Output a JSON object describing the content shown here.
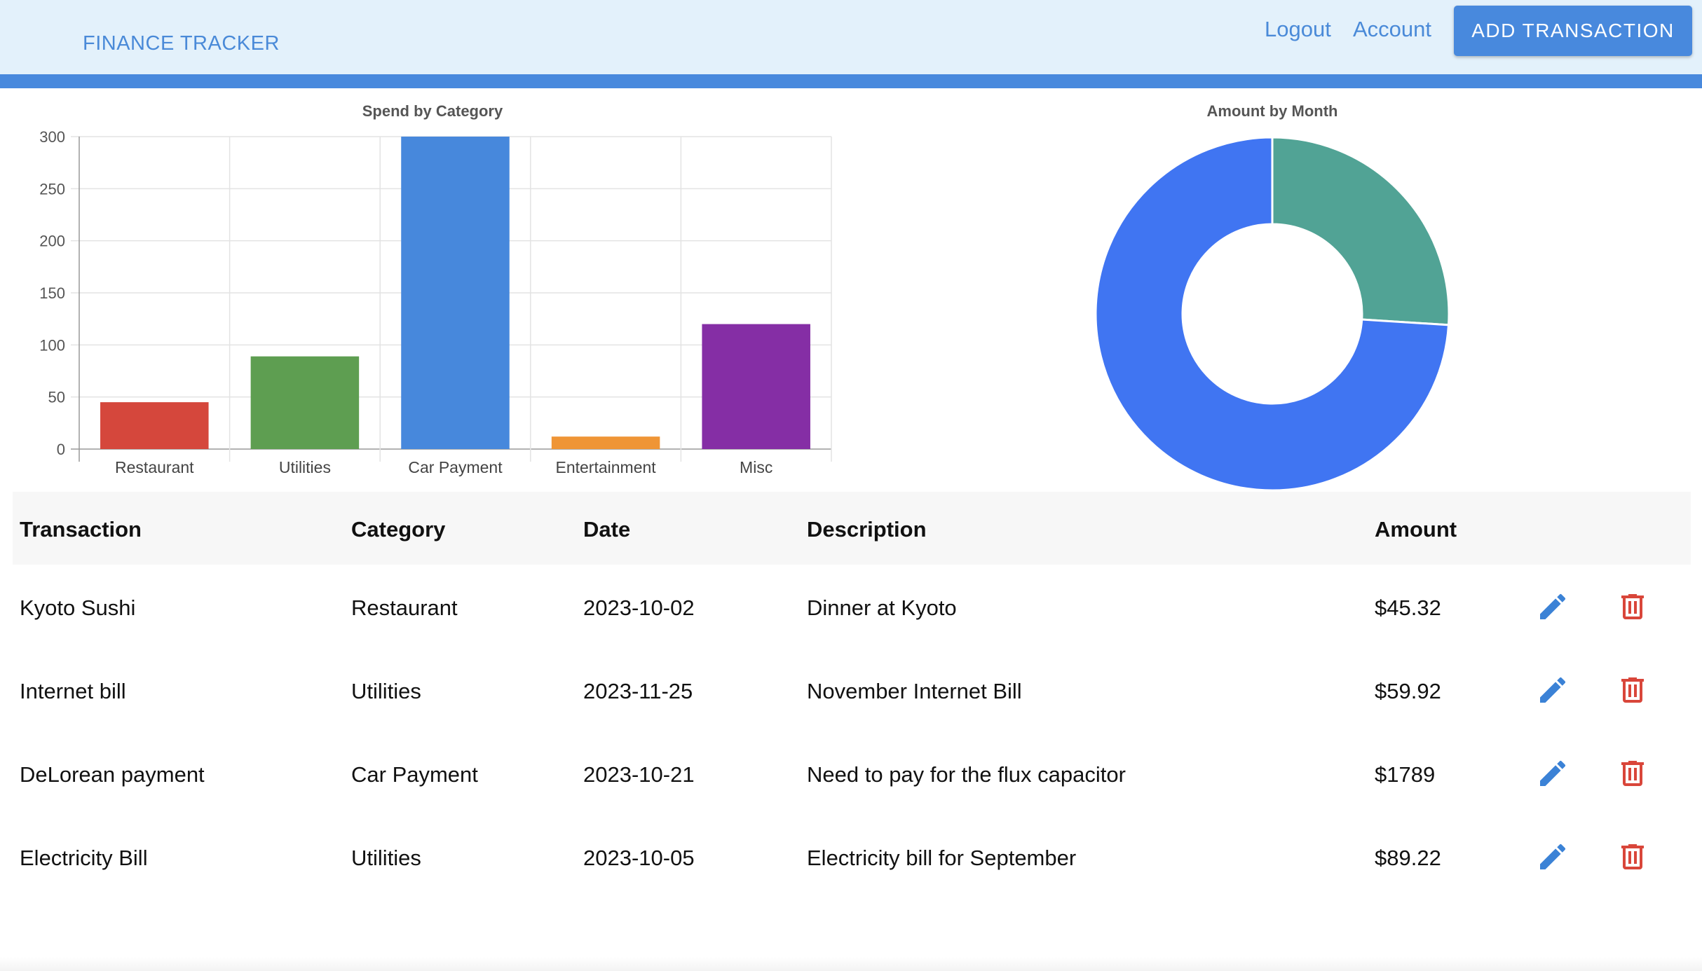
{
  "header": {
    "brand": "FINANCE TRACKER",
    "logout_label": "Logout",
    "account_label": "Account",
    "add_transaction_label": "ADD TRANSACTION"
  },
  "colors": {
    "accent": "#4889dd",
    "header_bg": "#e3f1fb",
    "edit_icon": "#3b82d6",
    "delete_icon": "#d9463a"
  },
  "chart_data": [
    {
      "type": "bar",
      "title": "Spend by Category",
      "categories": [
        "Restaurant",
        "Utilities",
        "Car Payment",
        "Entertainment",
        "Misc"
      ],
      "values": [
        45,
        89,
        300,
        12,
        120
      ],
      "colors": [
        "#d5473c",
        "#5e9e51",
        "#4788dc",
        "#ef9536",
        "#852ea5"
      ],
      "yticks": [
        0,
        50,
        100,
        150,
        200,
        250,
        300
      ],
      "ylim": [
        0,
        300
      ],
      "grid": true,
      "legend": "none"
    },
    {
      "type": "pie",
      "subtype": "donut",
      "title": "Amount by Month",
      "values": [
        1789,
        45
      ],
      "display_fractions": [
        0.74,
        0.26
      ],
      "colors": [
        "#4075f2",
        "#51a395"
      ],
      "legend": "none"
    }
  ],
  "table": {
    "headers": [
      "Transaction",
      "Category",
      "Date",
      "Description",
      "Amount"
    ],
    "rows": [
      [
        "Kyoto Sushi",
        "Restaurant",
        "2023-10-02",
        "Dinner at Kyoto",
        "$45.32"
      ],
      [
        "Internet bill",
        "Utilities",
        "2023-11-25",
        "November Internet Bill",
        "$59.92"
      ],
      [
        "DeLorean payment",
        "Car Payment",
        "2023-10-21",
        "Need to pay for the flux capacitor",
        "$1789"
      ],
      [
        "Electricity Bill",
        "Utilities",
        "2023-10-05",
        "Electricity bill for September",
        "$89.22"
      ]
    ],
    "row_icons": [
      "pencil-icon",
      "trash-icon"
    ]
  }
}
